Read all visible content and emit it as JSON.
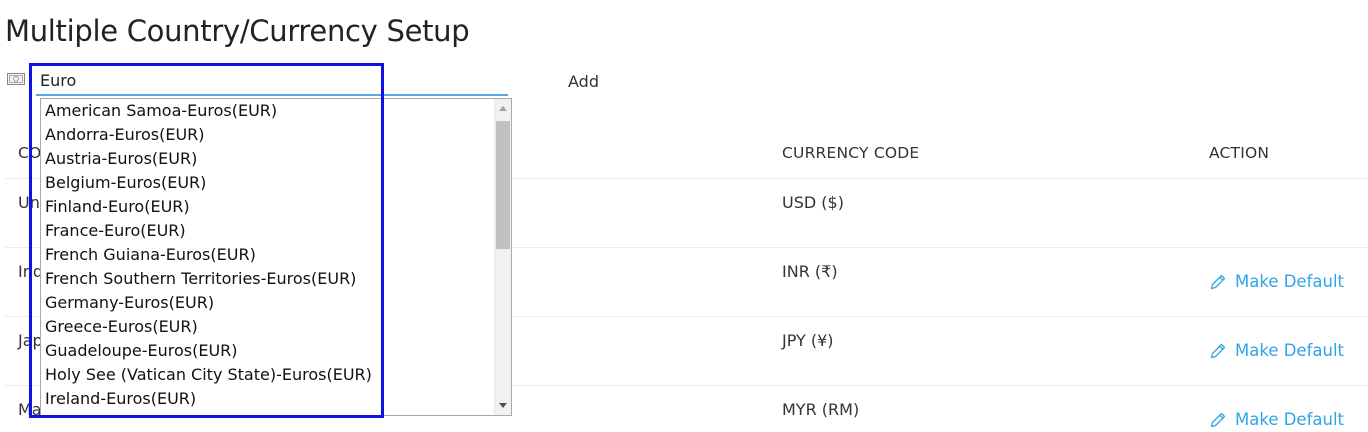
{
  "page": {
    "title": "Multiple Country/Currency Setup"
  },
  "search": {
    "value": "Euro",
    "add_label": "Add"
  },
  "table": {
    "headers": {
      "country": "CO",
      "currency_code": "CURRENCY CODE",
      "action": "ACTION"
    },
    "rows": [
      {
        "country": "Uni",
        "currency": "USD ($)",
        "action": ""
      },
      {
        "country": "Ind",
        "currency": "INR (₹)",
        "action": "Make Default"
      },
      {
        "country": "Jap",
        "currency": "JPY (¥)",
        "action": "Make Default"
      },
      {
        "country": "Ma",
        "currency": "MYR (RM)",
        "action": "Make Default"
      }
    ]
  },
  "dropdown": {
    "options": [
      "American Samoa-Euros(EUR)",
      "Andorra-Euros(EUR)",
      "Austria-Euros(EUR)",
      "Belgium-Euros(EUR)",
      "Finland-Euro(EUR)",
      "France-Euro(EUR)",
      "French Guiana-Euros(EUR)",
      "French Southern Territories-Euros(EUR)",
      "Germany-Euros(EUR)",
      "Greece-Euros(EUR)",
      "Guadeloupe-Euros(EUR)",
      "Holy See (Vatican City State)-Euros(EUR)",
      "Ireland-Euros(EUR)"
    ]
  },
  "colors": {
    "link": "#2fa4e7",
    "highlight_border": "#1010e6",
    "input_underline": "#5aa7e0"
  },
  "icons": {
    "currency": "money-icon",
    "edit": "pencil-icon"
  }
}
